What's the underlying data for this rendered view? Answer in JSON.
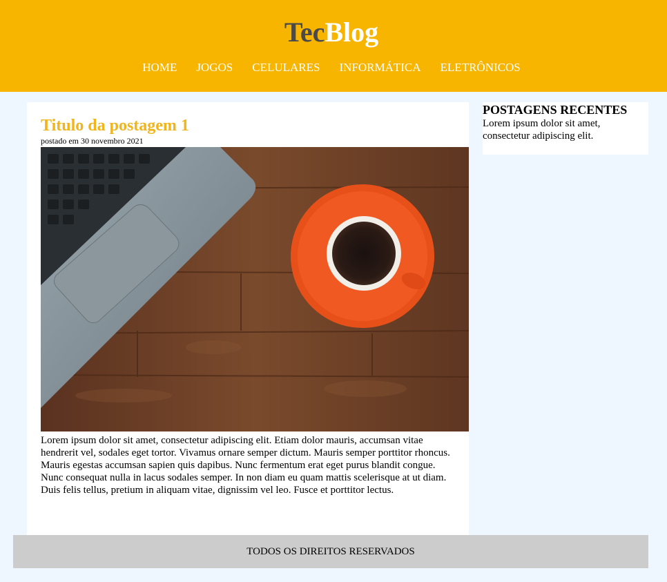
{
  "header": {
    "logo_part1": "Tec",
    "logo_part2": "Blog",
    "nav": [
      "HOME",
      "JOGOS",
      "CELULARES",
      "INFORMÁTICA",
      "ELETRÔNICOS"
    ]
  },
  "post": {
    "title": "Titulo da postagem 1",
    "date": "postado em 30 novembro 2021",
    "body": "Lorem ipsum dolor sit amet, consectetur adipiscing elit. Etiam dolor mauris, accumsan vitae hendrerit vel, sodales eget tortor. Vivamus ornare semper dictum. Mauris semper porttitor rhoncus. Mauris egestas accumsan sapien quis dapibus. Nunc fermentum erat eget purus blandit congue. Nunc consequat nulla in lacus sodales semper. In non diam eu quam mattis scelerisque at ut diam. Duis felis tellus, pretium in aliquam vitae, dignissim vel leo. Fusce et porttitor lectus."
  },
  "sidebar": {
    "title": "POSTAGENS RECENTES",
    "text": "Lorem ipsum dolor sit amet, consectetur adipiscing elit."
  },
  "footer": {
    "text": "TODOS OS DIREITOS RESERVADOS"
  },
  "colors": {
    "header_bg": "#f7b500",
    "title_accent": "#f0b41c",
    "page_bg": "#eef6ff",
    "footer_bg": "#cccccc"
  }
}
